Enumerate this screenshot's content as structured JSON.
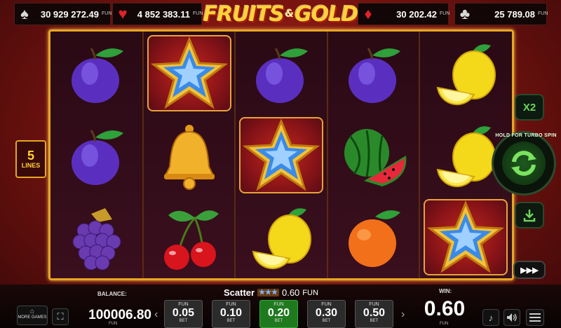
{
  "header": {
    "logo_text_1": "FRUITS",
    "logo_amp": "&",
    "logo_text_2": "GOLD",
    "jackpots": [
      {
        "suit": "spade",
        "glyph": "♠",
        "amount": "30 929 272.49",
        "currency": "FUN"
      },
      {
        "suit": "heart",
        "glyph": "♥",
        "amount": "4 852 383.11",
        "currency": "FUN"
      },
      {
        "suit": "diamond",
        "glyph": "♦",
        "amount": "30 202.42",
        "currency": "FUN"
      },
      {
        "suit": "club",
        "glyph": "♣",
        "amount": "25 789.08",
        "currency": "FUN"
      }
    ]
  },
  "reels": [
    [
      "plum",
      "plum",
      "grapes"
    ],
    [
      "star",
      "bell",
      "cherry"
    ],
    [
      "plum",
      "star",
      "lemon"
    ],
    [
      "plum",
      "watermelon",
      "orange"
    ],
    [
      "lemon",
      "lemon",
      "star"
    ]
  ],
  "lines": {
    "count": "5",
    "label": "LINES"
  },
  "controls": {
    "multiplier": "X2",
    "spin_hint": "HOLD FOR TURBO SPIN",
    "autoplay_glyph": "▶▶▶"
  },
  "bottom": {
    "balance_label": "BALANCE:",
    "balance_value": "100006.80",
    "balance_currency": "FUN",
    "more_games_label": "MORE GAMES",
    "scatter_label": "Scatter",
    "scatter_value": "0.60",
    "scatter_currency": "FUN",
    "bets": [
      {
        "currency": "FUN",
        "value": "0.05",
        "label": "BET",
        "active": false
      },
      {
        "currency": "FUN",
        "value": "0.10",
        "label": "BET",
        "active": false
      },
      {
        "currency": "FUN",
        "value": "0.20",
        "label": "BET",
        "active": true
      },
      {
        "currency": "FUN",
        "value": "0.30",
        "label": "BET",
        "active": false
      },
      {
        "currency": "FUN",
        "value": "0.50",
        "label": "BET",
        "active": false
      }
    ],
    "win_label": "WIN:",
    "win_value": "0.60",
    "win_currency": "FUN"
  }
}
